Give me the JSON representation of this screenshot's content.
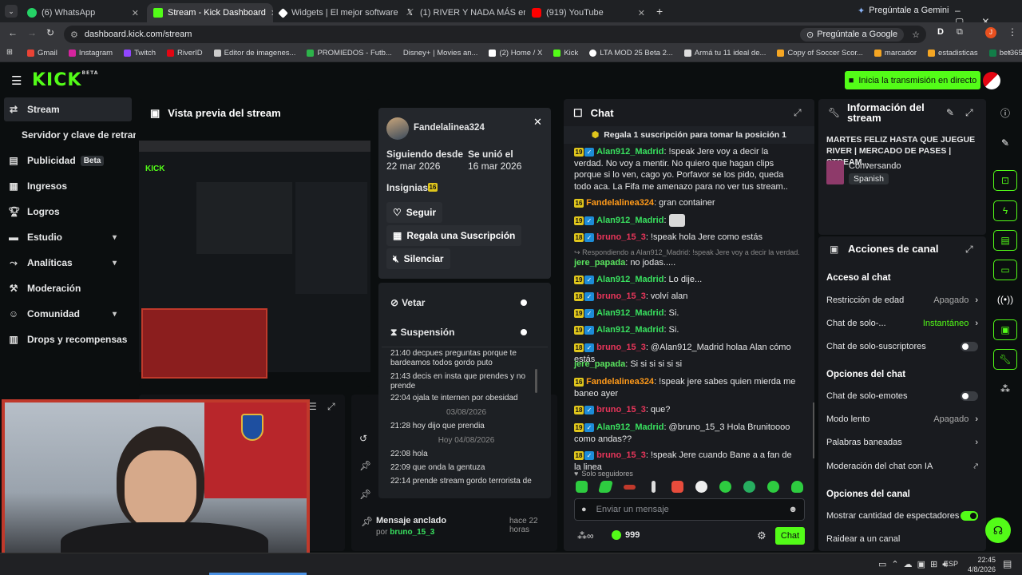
{
  "browser": {
    "tabs": [
      {
        "label": "(6) WhatsApp",
        "color": "#25d366"
      },
      {
        "label": "Stream - Kick Dashboard",
        "color": "#53fc18"
      },
      {
        "label": "Widgets | El mejor software pa",
        "color": "#ffffff"
      },
      {
        "label": "(1) RIVER Y NADA MÁS en X: \"J",
        "color": "#ffffff"
      },
      {
        "label": "(919) YouTube",
        "color": "#ff0000"
      }
    ],
    "gemini": "Pregúntale a Gemini",
    "url": "dashboard.kick.com/stream",
    "ask_google": "Pregúntale a Google",
    "bookmarks": [
      "Gmail",
      "Instagram",
      "Twitch",
      "RiverID",
      "Editor de imagenes...",
      "PROMIEDOS - Futb...",
      "Disney+ | Movies an...",
      "(2) Home / X",
      "Kick",
      "LTA MOD 25 Beta 2...",
      "Armá tu 11 ideal de...",
      "Copy of Soccer Scor...",
      "marcador",
      "estadisticas",
      "bet365 - Apuestas d..."
    ]
  },
  "top": {
    "logo": "KICK",
    "logo_sup": "BETA",
    "cta": "Inicia la transmisión en directo"
  },
  "sidebar": {
    "items": [
      {
        "label": "Stream"
      },
      {
        "label": "Servidor y clave de retransm"
      },
      {
        "label": "Publicidad",
        "badge": "Beta"
      },
      {
        "label": "Ingresos"
      },
      {
        "label": "Logros"
      },
      {
        "label": "Estudio"
      },
      {
        "label": "Analíticas"
      },
      {
        "label": "Moderación"
      },
      {
        "label": "Comunidad"
      },
      {
        "label": "Drops y recompensas"
      }
    ]
  },
  "preview": {
    "title": "Vista previa del stream"
  },
  "user_card": {
    "name": "Fandelalinea324",
    "following_label": "Siguiendo desde",
    "following_date": "22 mar 2026",
    "joined_label": "Se unió el",
    "joined_date": "16 mar 2026",
    "insignias": "Insignias",
    "insignia_num": "16",
    "follow": "Seguir",
    "gift": "Regala una Suscripción",
    "mute": "Silenciar",
    "vetar": "Vetar",
    "suspension": "Suspensión",
    "history": [
      {
        "t": "21:40 decpues preguntas porque te"
      },
      {
        "t": "bardeamos todos gordo puto"
      },
      {
        "t": "21:43 decis en insta que prendes y no prende"
      },
      {
        "t": "22:04 ojala te internen por obesidad"
      },
      {
        "sep": "03/08/2026"
      },
      {
        "t": "21:28 hoy dijo que prendia"
      },
      {
        "sep": "Hoy 04/08/2026"
      },
      {
        "t": "22:08 hola"
      },
      {
        "t": "22:09 que onda la gentuza"
      },
      {
        "t": "22:14 prende stream gordo terrorista de"
      }
    ]
  },
  "pinned": {
    "title": "Mensaje anclado",
    "time": "hace 22 horas",
    "by_label": "por",
    "by": "bruno_15_3"
  },
  "chat": {
    "title": "Chat",
    "gift_banner": "Regala 1 suscripción para tomar la posición 1",
    "messages": [
      {
        "badge": "19",
        "user": "Alan912_Madrid",
        "cls": "u1",
        "text": ": !speak Jere voy a decir la verdad. No voy a mentir. No quiero que hagan clips porque si lo ven, cago yo. Porfavor se los pido, queda todo aca. La Fifa me amenazo para no ver tus stream.."
      },
      {
        "badge": "16",
        "user": "Fandelalinea324",
        "cls": "u2",
        "text": ": gran container"
      },
      {
        "badge": "19",
        "user": "Alan912_Madrid",
        "cls": "u1",
        "text": ":"
      },
      {
        "badge": "18",
        "user": "bruno_15_3",
        "cls": "u3",
        "text": ": !speak hola Jere como estás"
      },
      {
        "reply": "Respondiendo a Alan912_Madrid: !speak Jere voy a decir la verdad. N...",
        "user": "jere_papada",
        "cls": "u4",
        "text": ": no jodas....."
      },
      {
        "badge": "19",
        "user": "Alan912_Madrid",
        "cls": "u1",
        "text": ": Lo dije..."
      },
      {
        "badge": "18",
        "user": "bruno_15_3",
        "cls": "u3",
        "text": ": volví alan"
      },
      {
        "badge": "19",
        "user": "Alan912_Madrid",
        "cls": "u1",
        "text": ": Si."
      },
      {
        "badge": "19",
        "user": "Alan912_Madrid",
        "cls": "u1",
        "text": ": Si."
      },
      {
        "badge": "18",
        "user": "bruno_15_3",
        "cls": "u3",
        "text": ": @Alan912_Madrid holaa Alan cómo estás"
      },
      {
        "user": "jere_papada",
        "cls": "u4",
        "text": ": Si si si si si si"
      },
      {
        "badge": "16",
        "user": "Fandelalinea324",
        "cls": "u2",
        "text": ": !speak jere sabes quien mierda me baneo ayer"
      },
      {
        "badge": "18",
        "user": "bruno_15_3",
        "cls": "u3",
        "text": ": que?"
      },
      {
        "badge": "19",
        "user": "Alan912_Madrid",
        "cls": "u1",
        "text": ": @bruno_15_3 Hola Brunitoooo como andas??"
      },
      {
        "badge": "18",
        "user": "bruno_15_3",
        "cls": "u3",
        "text": ": !speak Jere cuando Bane a a fan de la linea"
      }
    ],
    "followers_only": "Solo seguidores",
    "placeholder": "Enviar un mensaje",
    "points": "999",
    "send": "Chat"
  },
  "info": {
    "title": "Información del stream",
    "stream_title": "MARTES FELIZ HASTA QUE JUEGUE RIVER | MERCADO DE PASES | STREAM...",
    "category": "Conversando",
    "lang": "Spanish"
  },
  "actions": {
    "title": "Acciones de canal",
    "sections": [
      {
        "label": "Acceso al chat",
        "rows": [
          {
            "label": "Restricción de edad",
            "value": "Apagado",
            "kind": "chev"
          },
          {
            "label": "Chat de solo-...",
            "value": "Instantáneo",
            "kind": "chev",
            "green": true
          },
          {
            "label": "Chat de solo-suscriptores",
            "kind": "toggle",
            "on": false
          }
        ]
      },
      {
        "label": "Opciones del chat",
        "rows": [
          {
            "label": "Chat de solo-emotes",
            "kind": "toggle",
            "on": false
          },
          {
            "label": "Modo lento",
            "value": "Apagado",
            "kind": "chev"
          },
          {
            "label": "Palabras baneadas",
            "kind": "chev"
          },
          {
            "label": "Moderación del chat con IA",
            "kind": "ext"
          }
        ]
      },
      {
        "label": "Opciones del canal",
        "rows": [
          {
            "label": "Mostrar cantidad de espectadores",
            "kind": "toggle",
            "on": true
          },
          {
            "label": "Raidear a un canal",
            "kind": "none"
          }
        ]
      }
    ]
  },
  "taskbar": {
    "lang": "ESP",
    "time": "22:45",
    "date": "4/8/2026"
  }
}
